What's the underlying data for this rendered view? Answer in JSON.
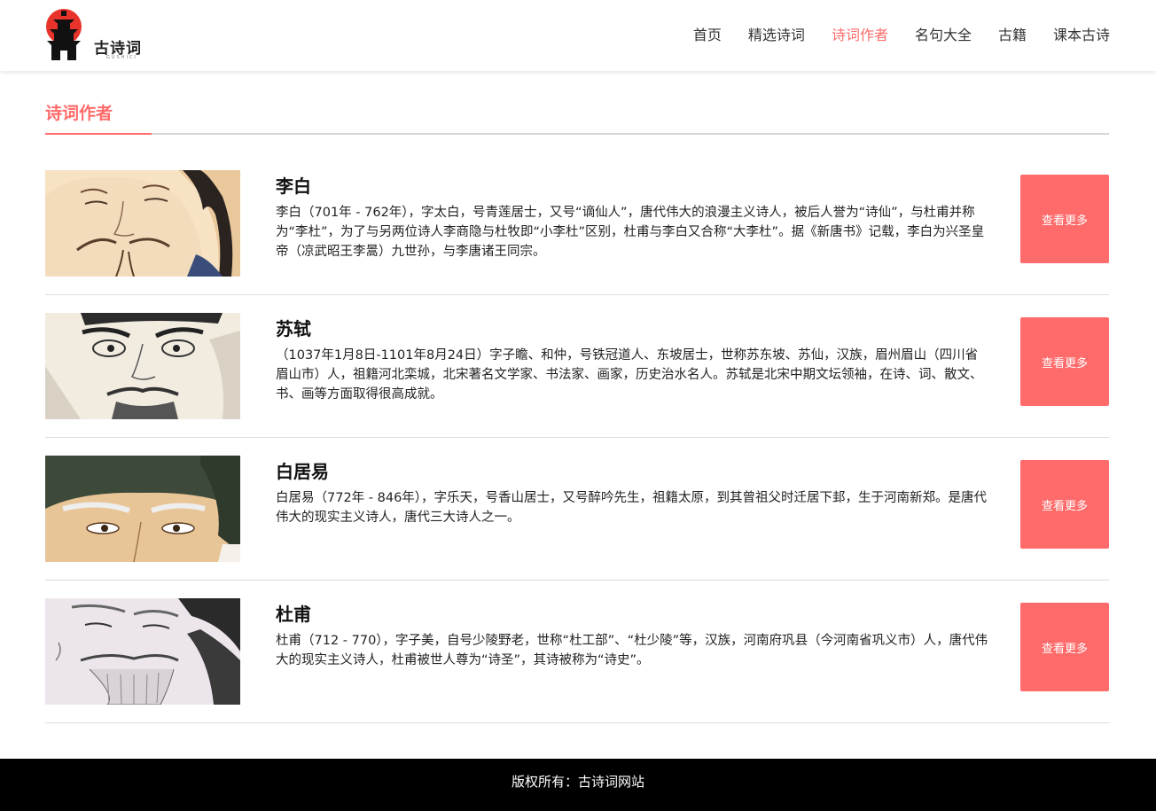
{
  "header": {
    "logo_text": "古诗词",
    "logo_sub": "GUSHICI",
    "nav": [
      {
        "label": "首页"
      },
      {
        "label": "精选诗词"
      },
      {
        "label": "诗词作者"
      },
      {
        "label": "名句大全"
      },
      {
        "label": "古籍"
      },
      {
        "label": "课本古诗"
      }
    ],
    "active_nav": "诗词作者"
  },
  "section": {
    "title": "诗词作者"
  },
  "authors": [
    {
      "name": "李白",
      "desc": "李白（701年 - 762年），字太白，号青莲居士，又号“谪仙人”，唐代伟大的浪漫主义诗人，被后人誉为“诗仙”，与杜甫并称为“李杜”，为了与另两位诗人李商隐与杜牧即“小李杜”区别，杜甫与李白又合称“大李杜”。据《新唐书》记载，李白为兴圣皇帝（凉武昭王李暠）九世孙，与李唐诸王同宗。",
      "button": "查看更多"
    },
    {
      "name": "苏轼",
      "desc": "（1037年1月8日-1101年8月24日）字子瞻、和仲，号铁冠道人、东坡居士，世称苏东坡、苏仙，汉族，眉州眉山（四川省眉山市）人，祖籍河北栾城，北宋著名文学家、书法家、画家，历史治水名人。苏轼是北宋中期文坛领袖，在诗、词、散文、书、画等方面取得很高成就。",
      "button": "查看更多"
    },
    {
      "name": "白居易",
      "desc": "白居易（772年 - 846年），字乐天，号香山居士，又号醉吟先生，祖籍太原，到其曾祖父时迁居下邽，生于河南新郑。是唐代伟大的现实主义诗人，唐代三大诗人之一。",
      "button": "查看更多"
    },
    {
      "name": "杜甫",
      "desc": "杜甫（712 - 770），字子美，自号少陵野老，世称“杜工部”、“杜少陵”等，汉族，河南府巩县（今河南省巩义市）人，唐代伟大的现实主义诗人，杜甫被世人尊为“诗圣”，其诗被称为“诗史”。",
      "button": "查看更多"
    }
  ],
  "footer": {
    "text": "版权所有：古诗词网站"
  },
  "colors": {
    "accent": "#ff6b6b",
    "footer_bg": "#000000",
    "logo_red": "#e8332a"
  }
}
